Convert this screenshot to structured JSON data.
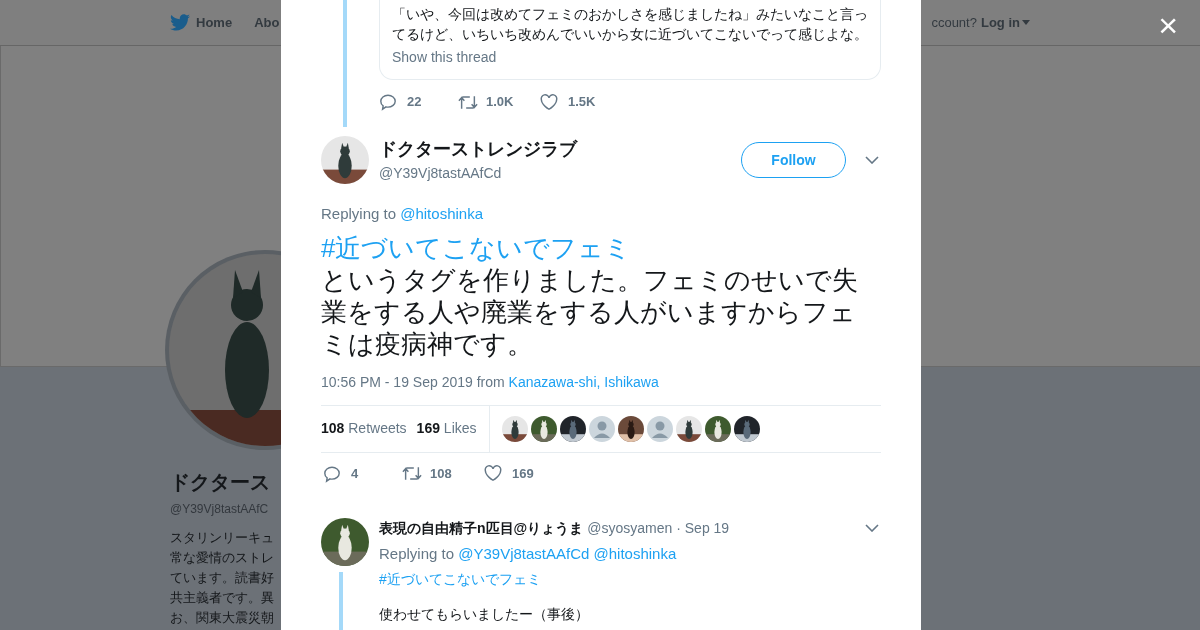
{
  "background": {
    "nav": {
      "home": "Home",
      "about": "Abo",
      "account_prompt": "ccount?",
      "login": "Log in"
    },
    "profile": {
      "name": "ドクタース",
      "handle": "@Y39Vj8tastAAfC",
      "bio_lines": [
        "スタリンリーキュ",
        "常な愛情のストレ",
        "ています。読書好",
        "共主義者です。異",
        "お、関東大震災朝"
      ]
    }
  },
  "close": "×",
  "previous_tweet": {
    "quote_lines": [
      "「いや、今回は改めてフェミのおかしさを感じましたね」みたいなこと言っ",
      "てるけど、いちいち改めんでいいから女に近づいてこないでって感じよな。"
    ],
    "show_thread": "Show this thread",
    "replies": "22",
    "retweets": "1.0K",
    "likes": "1.5K"
  },
  "tweet": {
    "name": "ドクターストレンジラブ",
    "handle": "@Y39Vj8tastAAfCd",
    "follow": "Follow",
    "replying_label": "Replying to",
    "replying_to": [
      "@hitoshinka"
    ],
    "hashtag": "#近づいてこないでフェミ",
    "text": "というタグを作りました。フェミのせいで失業をする人や廃業をする人がいますからフェミは疫病神です。",
    "time": "10:56 PM - 19 Sep 2019",
    "from": "from",
    "place": "Kanazawa-shi, Ishikawa",
    "retweet_count": "108",
    "retweet_label": "Retweets",
    "like_count": "169",
    "like_label": "Likes",
    "likers": [
      {
        "kind": "picture"
      },
      {
        "kind": "picture"
      },
      {
        "kind": "picture"
      },
      {
        "kind": "default"
      },
      {
        "kind": "picture"
      },
      {
        "kind": "default"
      },
      {
        "kind": "picture"
      },
      {
        "kind": "picture"
      },
      {
        "kind": "picture"
      }
    ],
    "replies": "4",
    "retweets": "108",
    "likes": "169"
  },
  "reply": {
    "name": "表現の自由精子n匹目@りょうま",
    "handle": "@syosyamen",
    "date": "· Sep 19",
    "replying_label": "Replying to",
    "replying_to": [
      "@Y39Vj8tastAAfCd",
      "@hitoshinka"
    ],
    "hashtag": "#近づいてこないでフェミ",
    "text": "使わせてもらいましたー（事後）"
  }
}
